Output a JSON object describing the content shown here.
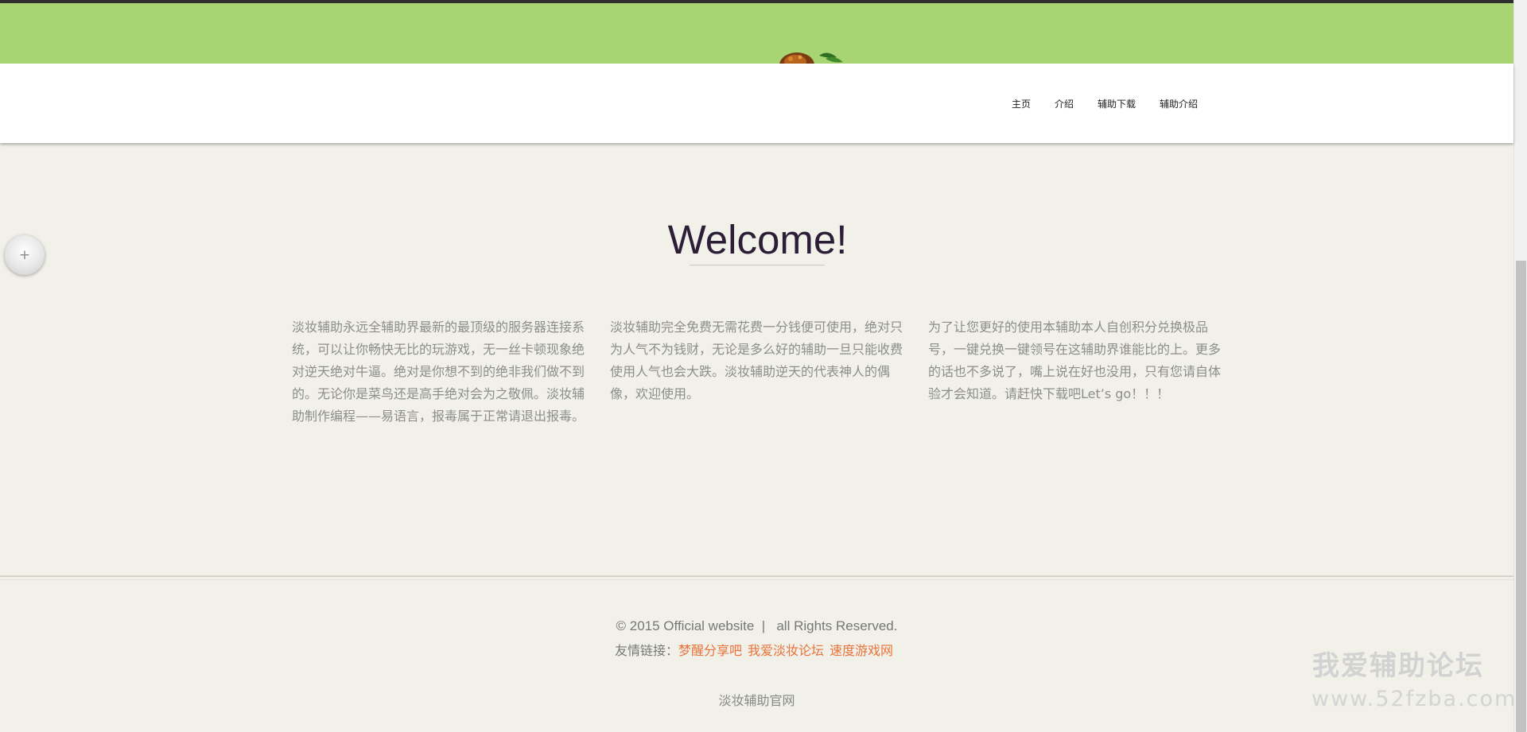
{
  "nav": {
    "items": [
      {
        "label": "主页"
      },
      {
        "label": "介绍"
      },
      {
        "label": "辅助下载"
      },
      {
        "label": "辅助介绍"
      }
    ]
  },
  "float_button": {
    "icon": "plus-icon",
    "symbol": "+"
  },
  "welcome": {
    "title": "Welcome!"
  },
  "columns": [
    {
      "text": "淡妆辅助永远全辅助界最新的最顶级的服务器连接系统，可以让你畅快无比的玩游戏，无一丝卡顿现象绝对逆天绝对牛逼。绝对是你想不到的绝非我们做不到的。无论你是菜鸟还是高手绝对会为之敬佩。淡妆辅助制作编程——易语言，报毒属于正常请退出报毒。"
    },
    {
      "text": "淡妆辅助完全免费无需花费一分钱便可使用，绝对只为人气不为钱财，无论是多么好的辅助一旦只能收费使用人气也会大跌。淡妆辅助逆天的代表神人的偶像，欢迎使用。"
    },
    {
      "text": "为了让您更好的使用本辅助本人自创积分兑换极品号，一键兑换一键领号在这辅助界谁能比的上。更多的话也不多说了，嘴上说在好也没用，只有您请自体验才会知道。请赶快下载吧Let’s go！！！"
    }
  ],
  "footer": {
    "copyright": "© 2015 Official website  |   all Rights Reserved.",
    "links_label": "友情链接：",
    "links": [
      {
        "label": "梦醒分享吧"
      },
      {
        "label": "我爱淡妆论坛"
      },
      {
        "label": "速度游戏网"
      }
    ],
    "site_name": "淡妆辅助官网"
  },
  "watermark": {
    "name": "我爱辅助论坛",
    "url": "www.52fzba.com"
  },
  "colors": {
    "banner": "#a9d473",
    "background": "#f1f0e9",
    "title": "#2d1e38",
    "link": "#e8743c"
  }
}
